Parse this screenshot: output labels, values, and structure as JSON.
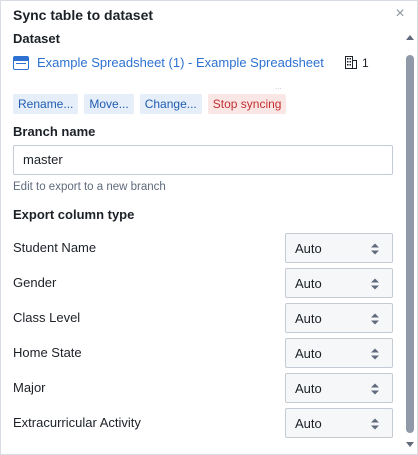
{
  "dialog": {
    "title": "Sync table to dataset",
    "close_icon": "close-icon"
  },
  "dataset": {
    "label": "Dataset",
    "icon": "table-icon",
    "link": "Example Spreadsheet (1) - Example Spreadsheet",
    "count_icon": "building-icon",
    "count": "1",
    "faint_mark": "..."
  },
  "actions": {
    "rename": "Rename...",
    "move": "Move...",
    "change": "Change...",
    "stop": "Stop syncing"
  },
  "branch": {
    "label": "Branch name",
    "value": "master",
    "helper": "Edit to export to a new branch"
  },
  "export": {
    "label": "Export column type",
    "columns": [
      {
        "name": "Student Name",
        "type": "Auto"
      },
      {
        "name": "Gender",
        "type": "Auto"
      },
      {
        "name": "Class Level",
        "type": "Auto"
      },
      {
        "name": "Home State",
        "type": "Auto"
      },
      {
        "name": "Major",
        "type": "Auto"
      },
      {
        "name": "Extracurricular Activity",
        "type": "Auto"
      }
    ]
  },
  "colors": {
    "link": "#2d72d2",
    "action_bg": "#e5eef9",
    "danger_bg": "#fbe6e6",
    "danger_text": "#c23030"
  }
}
